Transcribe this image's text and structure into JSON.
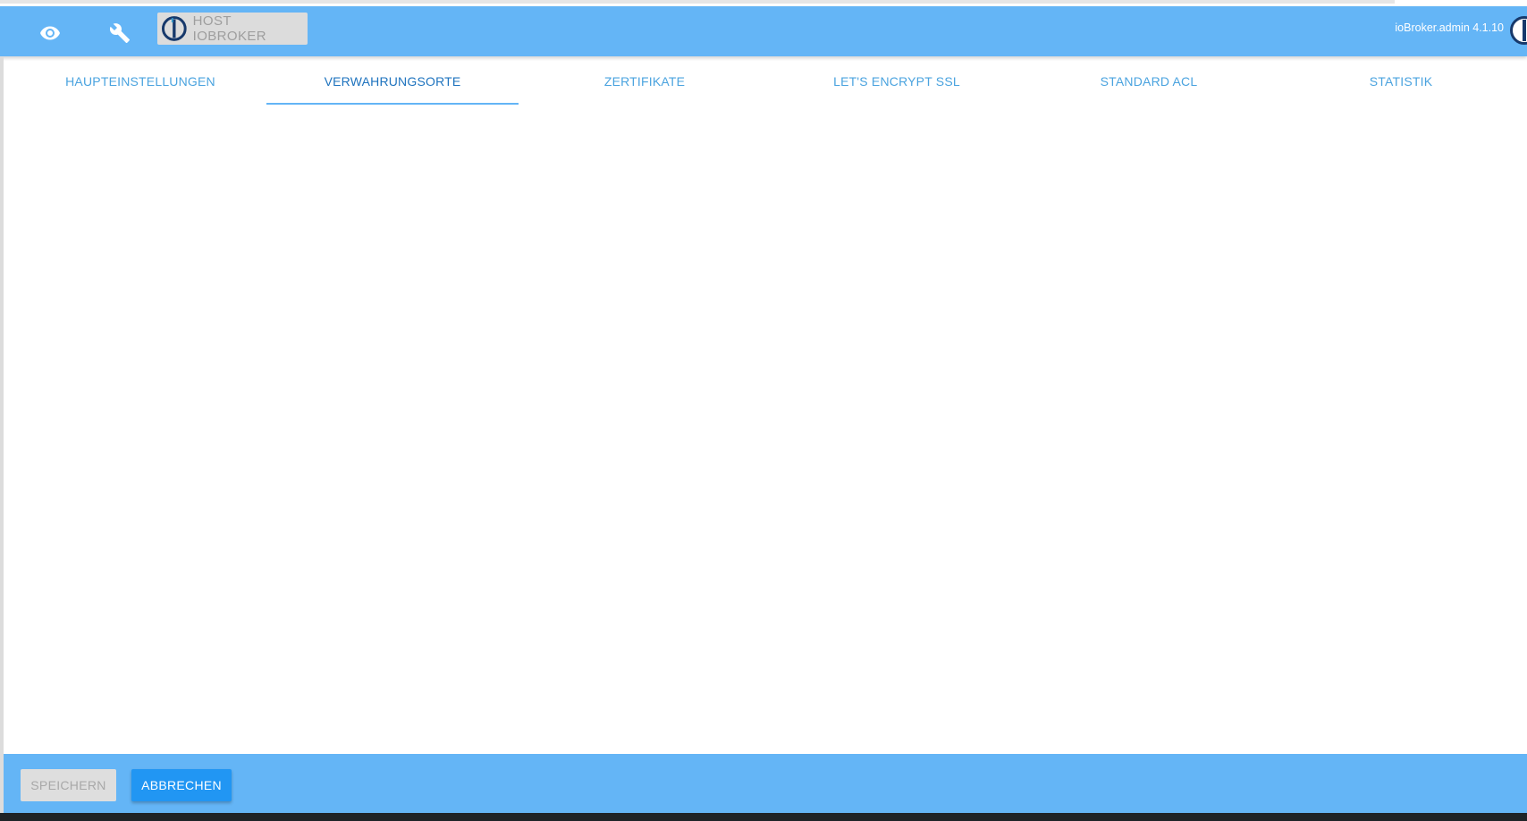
{
  "header": {
    "host_button_label": "HOST IOBROKER",
    "version": "ioBroker.admin 4.1.10",
    "icons": [
      "eye-icon",
      "wrench-icon",
      "iobroker-logo-icon"
    ]
  },
  "tabs": [
    {
      "label": "HAUPTEINSTELLUNGEN",
      "active": false
    },
    {
      "label": "VERWAHRUNGSORTE",
      "active": true
    },
    {
      "label": "ZERTIFIKATE",
      "active": false
    },
    {
      "label": "LET'S ENCRYPT SSL",
      "active": false
    },
    {
      "label": "STANDARD ACL",
      "active": false
    },
    {
      "label": "STATISTIK",
      "active": false
    }
  ],
  "footer": {
    "save_label": "SPEICHERN",
    "cancel_label": "ABBRECHEN"
  },
  "colors": {
    "header_bg": "#64b5f6",
    "tab_text": "#4aa3df",
    "tab_active_text": "#1e73be",
    "primary_button": "#2196f3",
    "disabled_button": "#dedede"
  }
}
